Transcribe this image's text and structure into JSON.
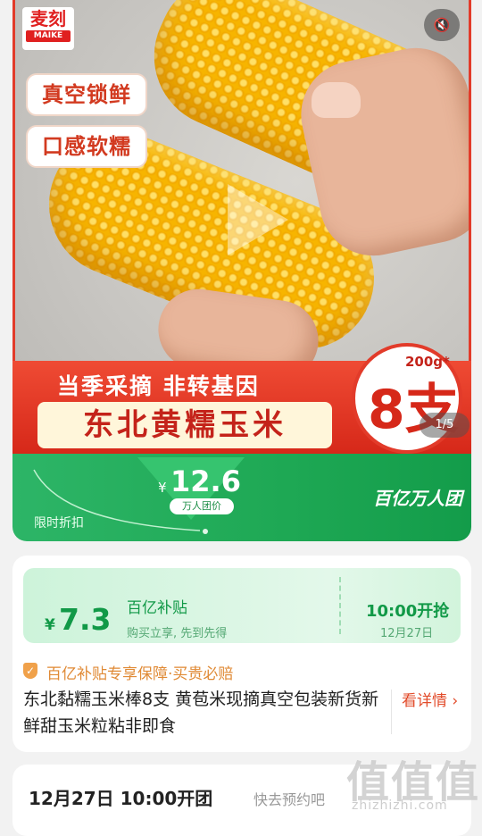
{
  "hero": {
    "logo_main": "麦刻",
    "logo_sub": "MAIKE",
    "mute_icon": "volume-mute-icon",
    "tags": [
      "真空锁鲜",
      "口感软糯"
    ],
    "band_line1": "当季采摘  非转基因",
    "band_line2": "东北黄糯玉米",
    "qty_weight": "200g*",
    "qty_count": "8支",
    "page_indicator": "1/5"
  },
  "deal": {
    "label": "限时折扣",
    "currency": "¥",
    "price": "12.6",
    "price_caption": "万人团价",
    "brand": "百亿万人团"
  },
  "coupon": {
    "currency": "¥",
    "value": "7.3",
    "title": "百亿补贴",
    "desc": "购买立享, 先到先得",
    "start_time": "10:00开抢",
    "start_date": "12月27日"
  },
  "guarantee": {
    "icon": "shield-check-icon",
    "text": "百亿补贴专享保障·买贵必赔"
  },
  "product": {
    "title": "东北黏糯玉米棒8支 黄苞米现摘真空包装新货新鲜甜玉米粒粘非即食",
    "details_label": "看详情 ›"
  },
  "event": {
    "time": "12月27日 10:00开团",
    "hint": "快去预约吧"
  },
  "watermark": {
    "chars": "值值值",
    "url": "zhizhizhi.com"
  },
  "colors": {
    "accent_red": "#d62819",
    "accent_green": "#1ea854"
  }
}
